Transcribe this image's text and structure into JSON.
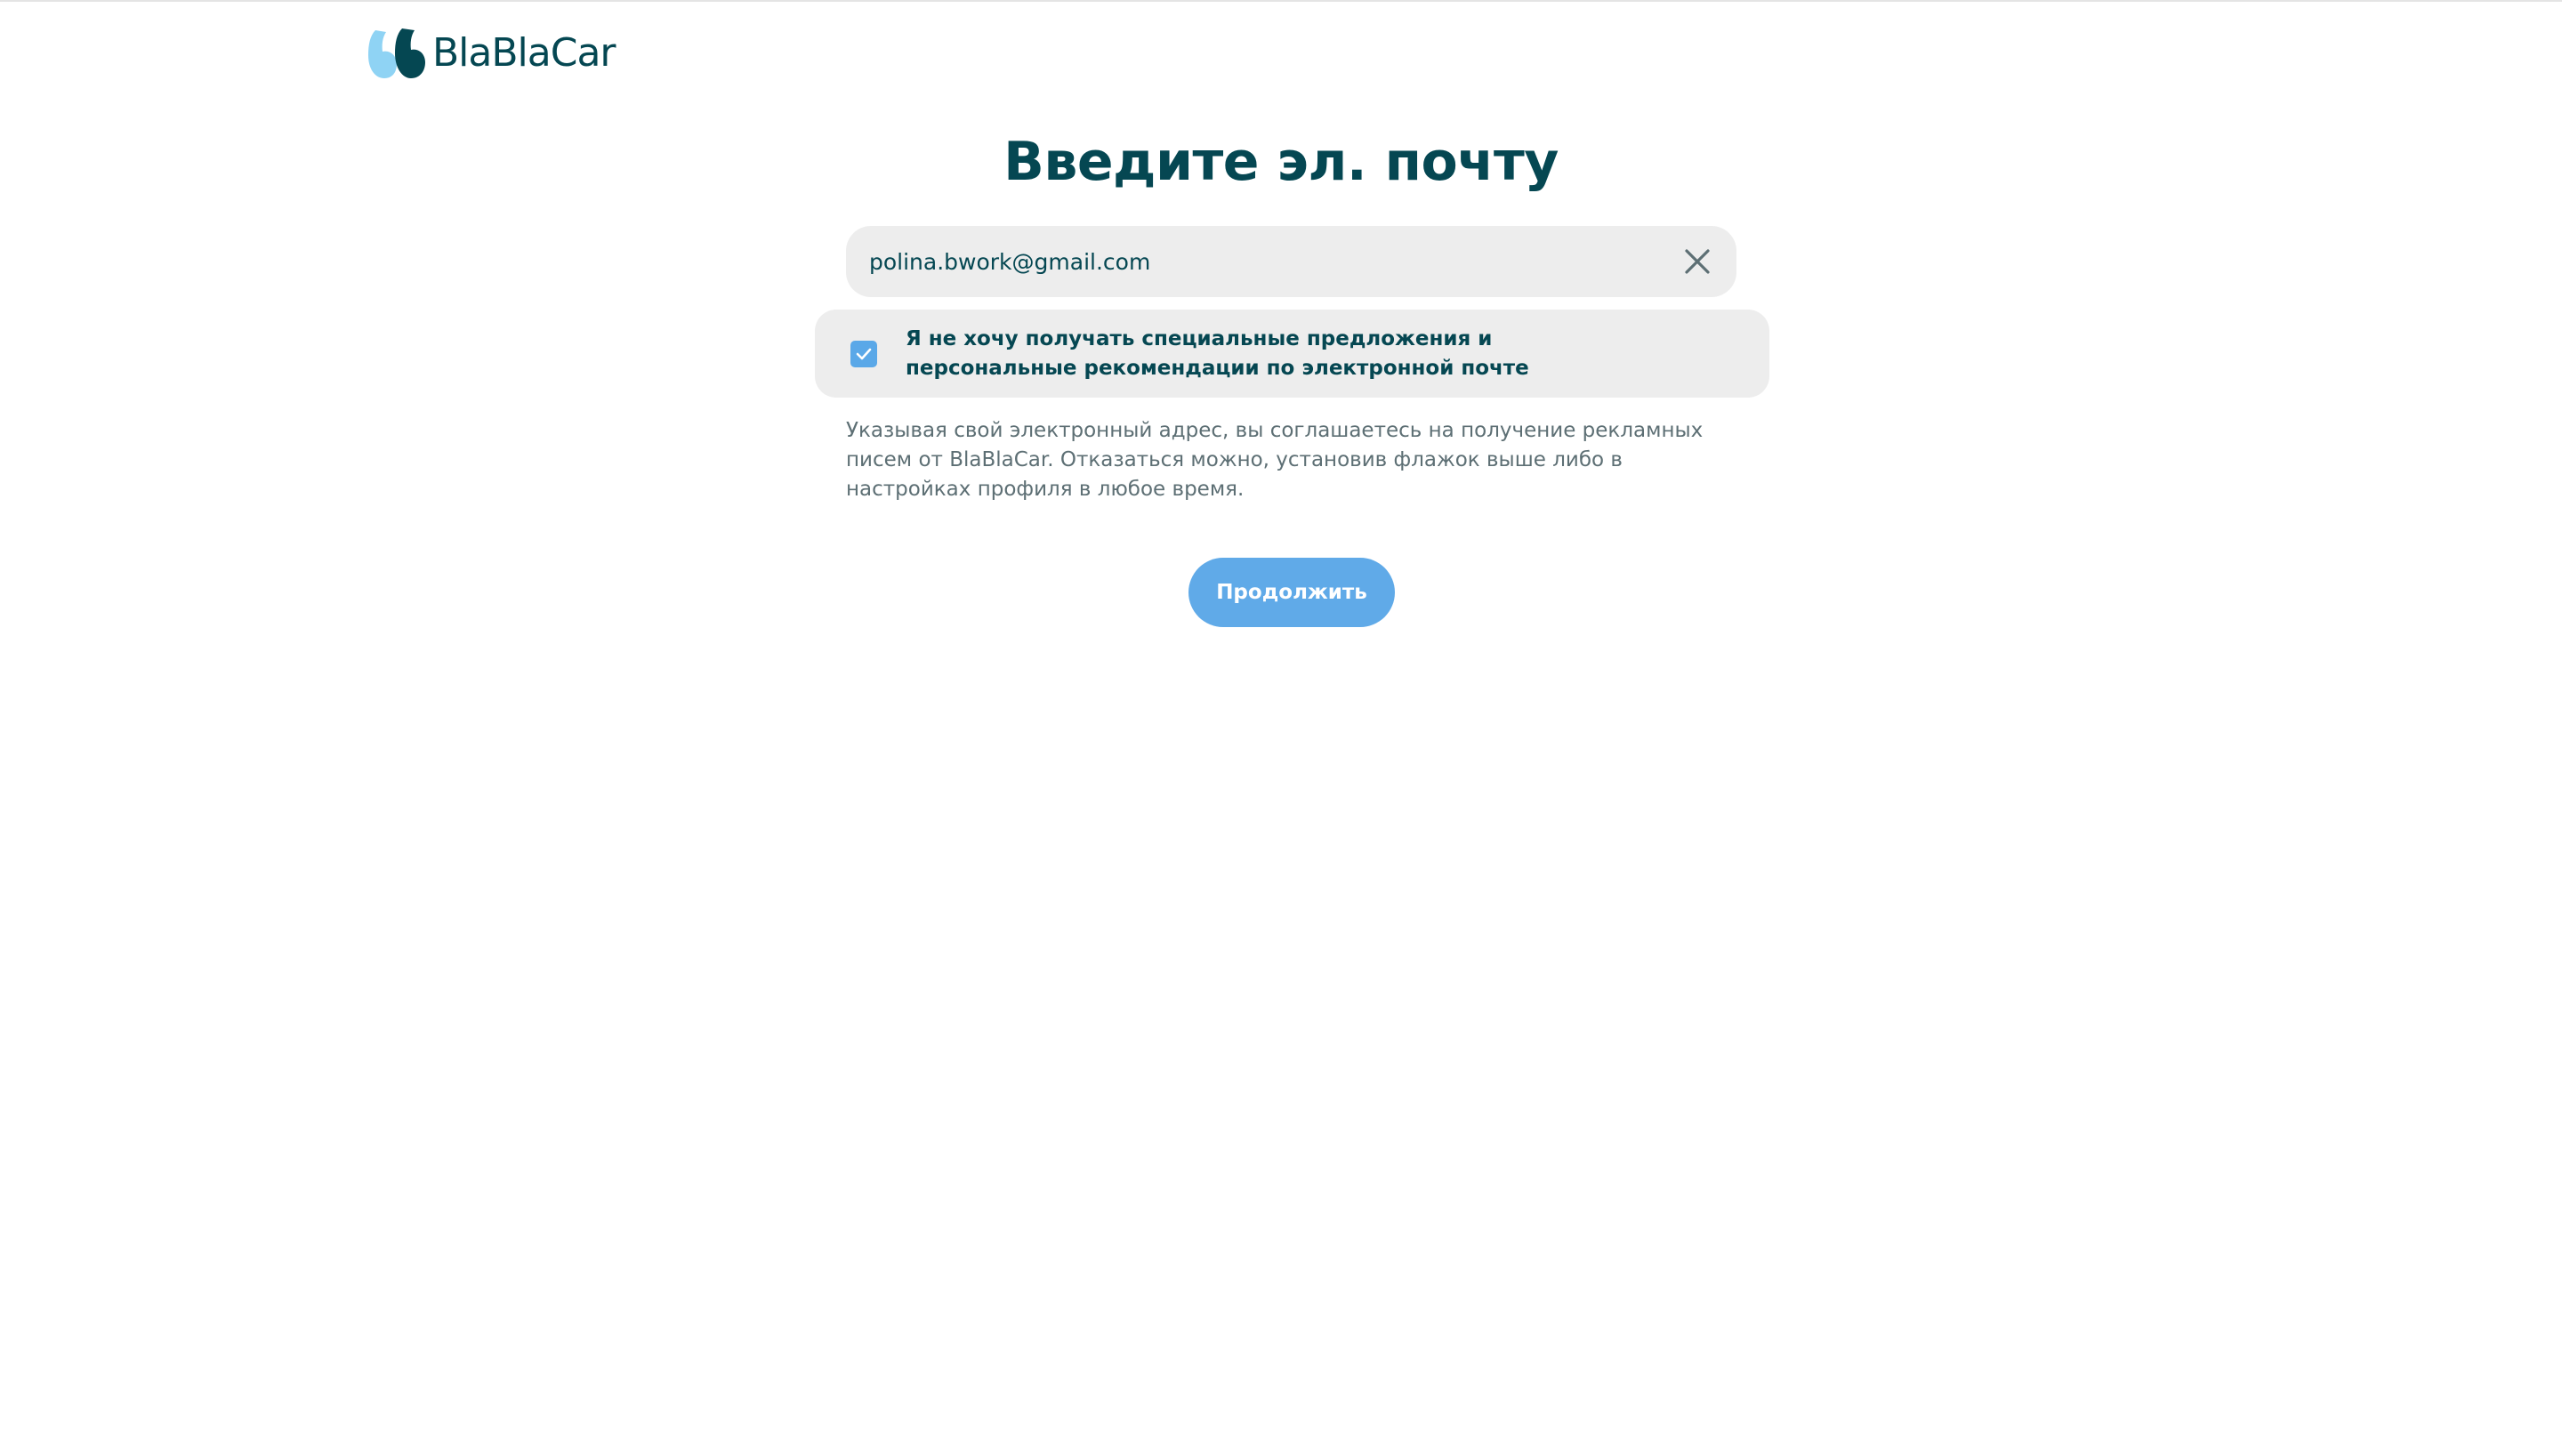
{
  "header": {
    "logo_text": "BlaBlaCar",
    "logo_icon": "blablacar-quote-logo"
  },
  "main": {
    "title": "Введите эл. почту",
    "email": {
      "value": "polina.bwork@gmail.com",
      "clear_icon": "close-icon"
    },
    "optout": {
      "checked": true,
      "label": "Я не хочу получать специальные предложения и персональные рекомендации по электронной почте"
    },
    "consent_text": "Указывая свой электронный адрес, вы соглашаетесь на получение рекламных писем от BlaBlaCar. Отказаться можно, установив флажок выше либо в настройках профиля в любое время.",
    "continue_label": "Продолжить"
  },
  "colors": {
    "brand_dark": "#054752",
    "accent_blue": "#60aae8",
    "field_bg": "#ededed",
    "logo_light_blue": "#8fd3f4"
  }
}
